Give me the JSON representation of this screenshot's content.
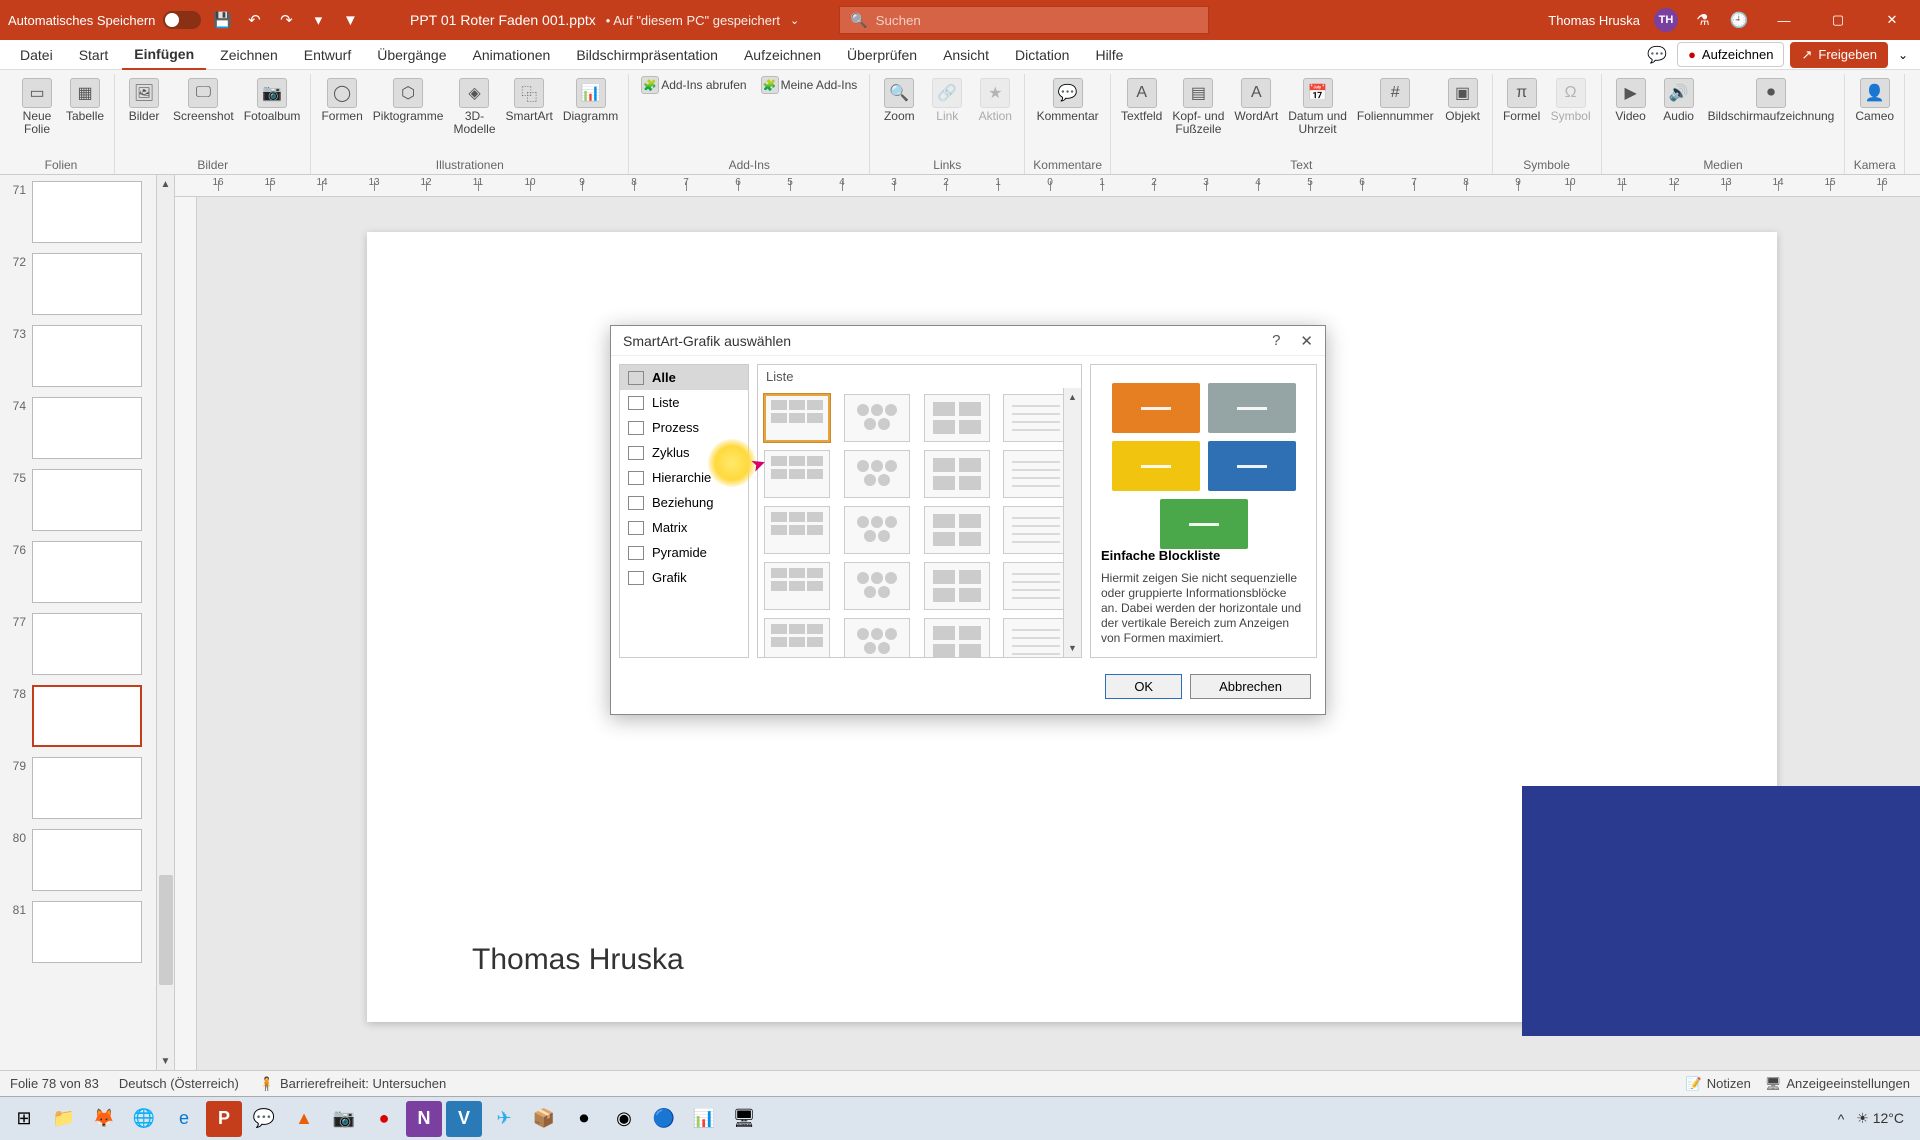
{
  "titlebar": {
    "autosave_label": "Automatisches Speichern",
    "filename": "PPT 01 Roter Faden 001.pptx",
    "saved_location": "• Auf \"diesem PC\" gespeichert",
    "search_placeholder": "Suchen",
    "username": "Thomas Hruska",
    "user_initials": "TH"
  },
  "tabs": {
    "items": [
      "Datei",
      "Start",
      "Einfügen",
      "Zeichnen",
      "Entwurf",
      "Übergänge",
      "Animationen",
      "Bildschirmpräsentation",
      "Aufzeichnen",
      "Überprüfen",
      "Ansicht",
      "Dictation",
      "Hilfe"
    ],
    "active": "Einfügen",
    "record": "Aufzeichnen",
    "share": "Freigeben"
  },
  "ribbon": {
    "groups": [
      {
        "label": "Folien",
        "buttons": [
          {
            "label": "Neue\nFolie",
            "icon": "▭"
          },
          {
            "label": "Tabelle",
            "icon": "▦"
          }
        ]
      },
      {
        "label": "Bilder",
        "buttons": [
          {
            "label": "Bilder",
            "icon": "🖼"
          },
          {
            "label": "Screenshot",
            "icon": "🖵"
          },
          {
            "label": "Fotoalbum",
            "icon": "📷"
          }
        ]
      },
      {
        "label": "Illustrationen",
        "buttons": [
          {
            "label": "Formen",
            "icon": "◯"
          },
          {
            "label": "Piktogramme",
            "icon": "⬡"
          },
          {
            "label": "3D-\nModelle",
            "icon": "◈"
          },
          {
            "label": "SmartArt",
            "icon": "⿻"
          },
          {
            "label": "Diagramm",
            "icon": "📊"
          }
        ]
      },
      {
        "label": "Add-Ins",
        "buttons": [
          {
            "label": "Add-Ins abrufen",
            "icon": "🧩",
            "small": true
          },
          {
            "label": "Meine Add-Ins",
            "icon": "🧩",
            "small": true
          }
        ]
      },
      {
        "label": "Links",
        "buttons": [
          {
            "label": "Zoom",
            "icon": "🔍"
          },
          {
            "label": "Link",
            "icon": "🔗",
            "disabled": true
          },
          {
            "label": "Aktion",
            "icon": "★",
            "disabled": true
          }
        ]
      },
      {
        "label": "Kommentare",
        "buttons": [
          {
            "label": "Kommentar",
            "icon": "💬"
          }
        ]
      },
      {
        "label": "Text",
        "buttons": [
          {
            "label": "Textfeld",
            "icon": "A"
          },
          {
            "label": "Kopf- und\nFußzeile",
            "icon": "▤"
          },
          {
            "label": "WordArt",
            "icon": "A"
          },
          {
            "label": "Datum und\nUhrzeit",
            "icon": "📅"
          },
          {
            "label": "Foliennummer",
            "icon": "#"
          },
          {
            "label": "Objekt",
            "icon": "▣"
          }
        ]
      },
      {
        "label": "Symbole",
        "buttons": [
          {
            "label": "Formel",
            "icon": "π"
          },
          {
            "label": "Symbol",
            "icon": "Ω",
            "disabled": true
          }
        ]
      },
      {
        "label": "Medien",
        "buttons": [
          {
            "label": "Video",
            "icon": "▶"
          },
          {
            "label": "Audio",
            "icon": "🔊"
          },
          {
            "label": "Bildschirmaufzeichnung",
            "icon": "⏺"
          }
        ]
      },
      {
        "label": "Kamera",
        "buttons": [
          {
            "label": "Cameo",
            "icon": "👤"
          }
        ]
      }
    ]
  },
  "thumbs": [
    {
      "num": "71"
    },
    {
      "num": "72"
    },
    {
      "num": "73"
    },
    {
      "num": "74"
    },
    {
      "num": "75"
    },
    {
      "num": "76"
    },
    {
      "num": "77"
    },
    {
      "num": "78",
      "selected": true
    },
    {
      "num": "79"
    },
    {
      "num": "80"
    },
    {
      "num": "81"
    }
  ],
  "slide": {
    "author": "Thomas Hruska"
  },
  "dialog": {
    "title": "SmartArt-Grafik auswählen",
    "categories": [
      {
        "label": "Alle",
        "selected": true
      },
      {
        "label": "Liste"
      },
      {
        "label": "Prozess"
      },
      {
        "label": "Zyklus"
      },
      {
        "label": "Hierarchie"
      },
      {
        "label": "Beziehung"
      },
      {
        "label": "Matrix"
      },
      {
        "label": "Pyramide"
      },
      {
        "label": "Grafik"
      }
    ],
    "gallery_header": "Liste",
    "preview": {
      "title": "Einfache Blockliste",
      "desc": "Hiermit zeigen Sie nicht sequenzielle oder gruppierte Informationsblöcke an. Dabei werden der horizontale und der vertikale Bereich zum Anzeigen von Formen maximiert.",
      "colors": [
        "#e67e22",
        "#95a5a6",
        "#f1c40f",
        "#2f6fb3",
        "#4aa84a"
      ]
    },
    "ok": "OK",
    "cancel": "Abbrechen"
  },
  "statusbar": {
    "slide_info": "Folie 78 von 83",
    "language": "Deutsch (Österreich)",
    "accessibility": "Barrierefreiheit: Untersuchen",
    "notes": "Notizen",
    "display_settings": "Anzeigeeinstellungen"
  },
  "taskbar": {
    "temp": "12°C"
  }
}
